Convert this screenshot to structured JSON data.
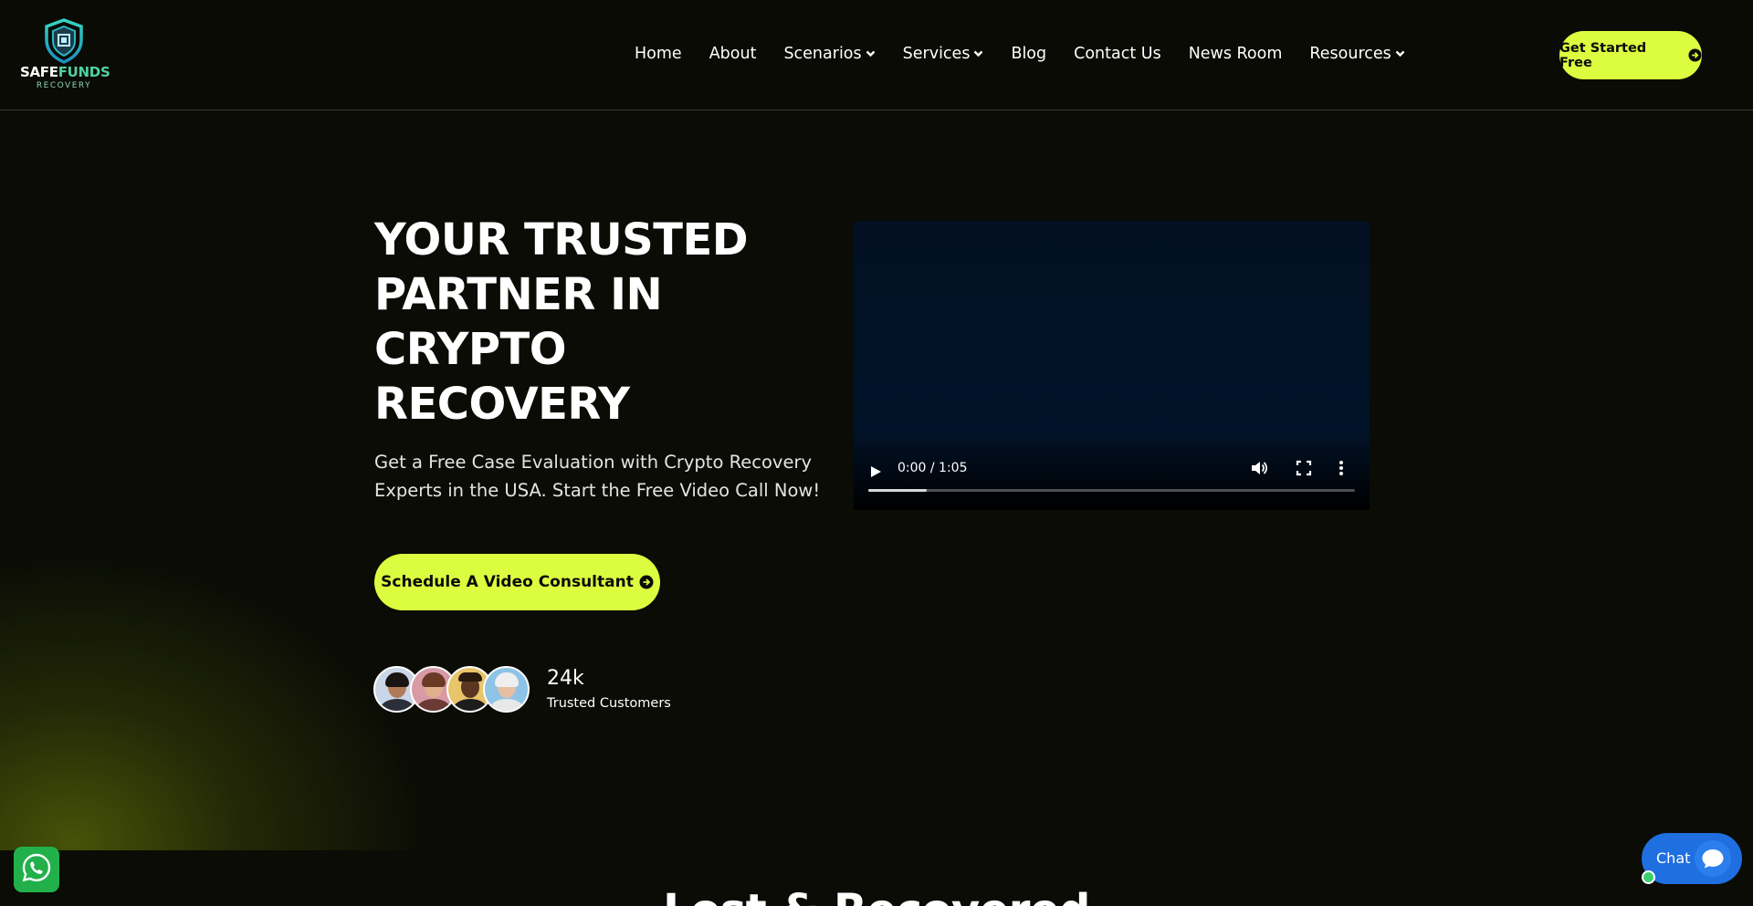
{
  "header": {
    "logo": {
      "word1": "SAFE",
      "word2": "FUNDS",
      "sub": "RECOVERY"
    },
    "nav": [
      {
        "label": "Home",
        "dropdown": false
      },
      {
        "label": "About",
        "dropdown": false
      },
      {
        "label": "Scenarios",
        "dropdown": true
      },
      {
        "label": "Services",
        "dropdown": true
      },
      {
        "label": "Blog",
        "dropdown": false
      },
      {
        "label": "Contact Us",
        "dropdown": false
      },
      {
        "label": "News Room",
        "dropdown": false
      },
      {
        "label": "Resources",
        "dropdown": true
      }
    ],
    "cta_label": "Get Started Free"
  },
  "hero": {
    "title": "YOUR TRUSTED PARTNER IN CRYPTO RECOVERY",
    "subtitle": "Get a Free Case Evaluation with Crypto Recovery Experts in the USA. Start the Free Video Call Now!",
    "button_label": "Schedule A Video Consultant",
    "stat_value": "24k",
    "stat_label": "Trusted Customers"
  },
  "video": {
    "time": "0:00 / 1:05",
    "buffered_fraction": 0.12
  },
  "next_section": {
    "heading_partial": "Lost & Recovered"
  },
  "chat": {
    "label": "Chat"
  },
  "colors": {
    "accent": "#dcfc3f",
    "background": "#0a0c05",
    "chat_blue": "#1f6fe0",
    "whatsapp_green": "#22b04b"
  },
  "icons": [
    "chevron-down-icon",
    "arrow-right-circle-icon",
    "play-icon",
    "volume-icon",
    "fullscreen-icon",
    "more-vertical-icon",
    "whatsapp-icon",
    "chat-bubble-icon",
    "shield-logo-icon"
  ]
}
